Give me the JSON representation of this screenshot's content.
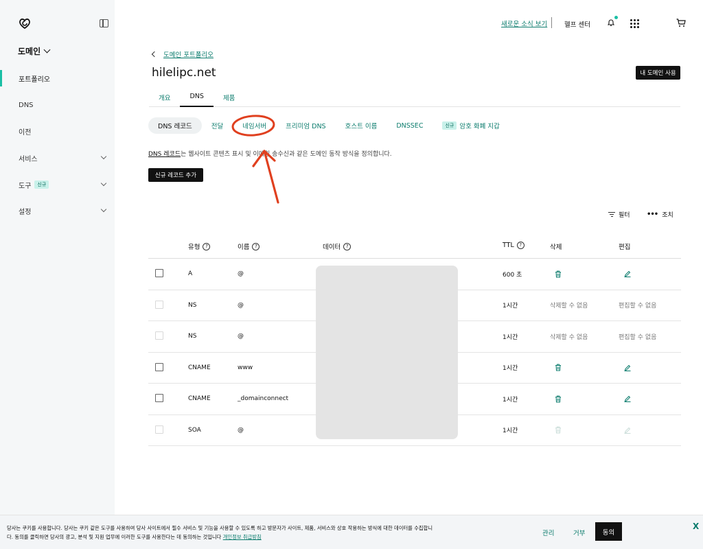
{
  "sidebar": {
    "product": "도메인",
    "items": [
      {
        "label": "포트폴리오"
      },
      {
        "label": "DNS"
      },
      {
        "label": "이전"
      },
      {
        "label": "서비스"
      },
      {
        "label": "도구",
        "badge": "신규"
      },
      {
        "label": "설정"
      }
    ]
  },
  "topbar": {
    "news": "새로운 소식 보기",
    "help": "헬프 센터"
  },
  "breadcrumb": "도메인 포트폴리오",
  "domain": "hilelipc.net",
  "use_button": "내 도메인 사용",
  "tabs": [
    "개요",
    "DNS",
    "제품"
  ],
  "subtabs": [
    {
      "label": "DNS 레코드"
    },
    {
      "label": "전달"
    },
    {
      "label": "네임서버"
    },
    {
      "label": "프리미엄 DNS"
    },
    {
      "label": "호스트 이름"
    },
    {
      "label": "DNSSEC"
    },
    {
      "label": "암호 화폐 지갑",
      "badge": "신규"
    }
  ],
  "description": {
    "link": "DNS 레코드",
    "text": "는 웹사이트 콘텐츠 표시 및 이메일 송수신과 같은 도메인 동작 방식을 정의합니다."
  },
  "add_record": "신규 레코드 추가",
  "filter": "필터",
  "actions": "조치",
  "table": {
    "headers": {
      "type": "유형",
      "name": "이름",
      "data": "데이터",
      "ttl": "TTL",
      "delete": "삭제",
      "edit": "편집"
    },
    "rows": [
      {
        "type": "A",
        "name": "@",
        "ttl": "600 초",
        "deletable": true,
        "del_text": "",
        "edit_text": ""
      },
      {
        "type": "NS",
        "name": "@",
        "ttl": "1시간",
        "deletable": false,
        "del_text": "삭제할 수 없음",
        "edit_text": "편집할 수 없음"
      },
      {
        "type": "NS",
        "name": "@",
        "ttl": "1시간",
        "deletable": false,
        "del_text": "삭제할 수 없음",
        "edit_text": "편집할 수 없음"
      },
      {
        "type": "CNAME",
        "name": "www",
        "ttl": "1시간",
        "deletable": true,
        "del_text": "",
        "edit_text": ""
      },
      {
        "type": "CNAME",
        "name": "_domainconnect",
        "ttl": "1시간",
        "deletable": true,
        "del_text": "",
        "edit_text": ""
      },
      {
        "type": "SOA",
        "name": "@",
        "ttl": "1시간",
        "deletable": "disabled",
        "del_text": "",
        "edit_text": ""
      }
    ]
  },
  "cookie": {
    "line1": "당사는 쿠키를 사용합니다. 당사는 쿠키 같은 도구를 사용하여 당사 사이트에서 필수 서비스 및 기능을 사용할 수 있도록 하고 방문자가 사이트, 제품, 서비스와 상호 작용하는 방식에 대한 데이터를 수집합니",
    "line2": "다. 동의를 클릭하면 당사의 광고, 분석 및 지원 업무에 이러한 도구를 사용한다는 데 동의하는 것입니다",
    "link": "개인정보 취급방침",
    "manage": "관리",
    "deny": "거부",
    "agree": "동의",
    "close": "X"
  },
  "colors": {
    "accent": "#0a7b6c",
    "active_bar": "#1bbfa5",
    "annotation": "#e0401f"
  }
}
